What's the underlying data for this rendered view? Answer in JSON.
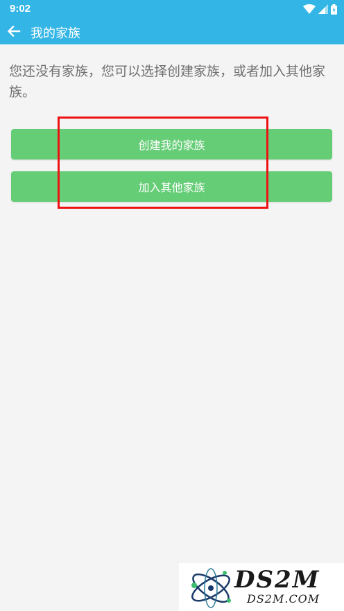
{
  "status_bar": {
    "time": "9:02",
    "icons": [
      "wifi-icon",
      "signal-icon",
      "battery-icon"
    ]
  },
  "app_bar": {
    "back_icon": "arrow-left-icon",
    "title": "我的家族"
  },
  "main": {
    "hint_text": "您还没有家族，您可以选择创建家族，或者加入其他家族。",
    "create_button_label": "创建我的家族",
    "join_button_label": "加入其他家族"
  },
  "watermark": {
    "logo": "DS2M",
    "url": "DS2M.COM"
  },
  "colors": {
    "primary": "#33b5e5",
    "button": "#66cd77",
    "highlight": "#ee1111",
    "background": "#f4f4f4"
  }
}
